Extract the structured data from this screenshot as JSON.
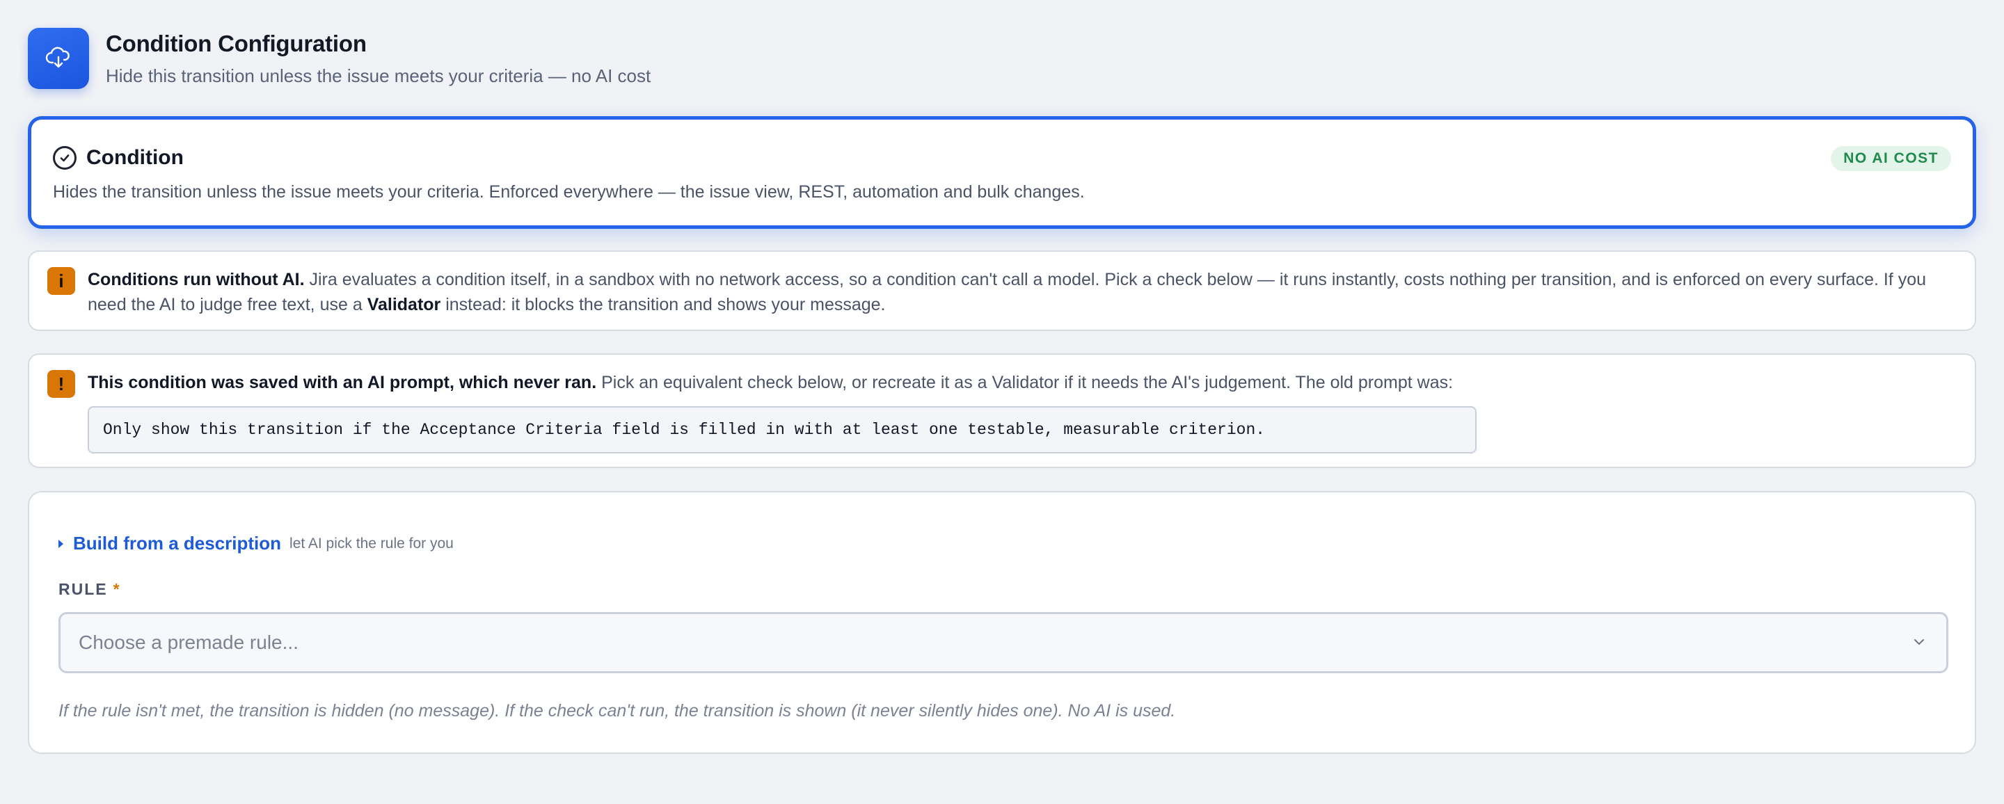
{
  "header": {
    "title": "Condition Configuration",
    "subtitle": "Hide this transition unless the issue meets your criteria — no AI cost",
    "icon": "cloud-download-icon"
  },
  "condition_card": {
    "title": "Condition",
    "badge": "NO AI COST",
    "description": "Hides the transition unless the issue meets your criteria. Enforced everywhere — the issue view, REST, automation and bulk changes.",
    "accent": "#2563eb"
  },
  "info_notice": {
    "marker": "i",
    "bold_lead": "Conditions run without AI.",
    "text_part1": " Jira evaluates a condition itself, in a sandbox with no network access, so a condition can't call a model. Pick a check below — it runs instantly, costs nothing per transition, and is enforced on every surface. If you need the AI to judge free text, use a ",
    "bold_validator": "Validator",
    "text_part2": " instead: it blocks the transition and shows your message."
  },
  "warning_notice": {
    "marker": "!",
    "bold_lead": "This condition was saved with an AI prompt, which never ran.",
    "text": " Pick an equivalent check below, or recreate it as a Validator if it needs the AI's judgement. The old prompt was:",
    "old_prompt": "Only show this transition if the Acceptance Criteria field is filled in with at least one testable, measurable criterion."
  },
  "rule_panel": {
    "build_link": "Build from a description",
    "build_hint": "let AI pick the rule for you",
    "rule_label": "RULE",
    "required_mark": "*",
    "select_placeholder": "Choose a premade rule...",
    "footnote": "If the rule isn't met, the transition is hidden (no message). If the check can't run, the transition is shown (it never silently hides one). No AI is used."
  },
  "colors": {
    "brand": "#2563eb",
    "warning": "#d97706",
    "success_badge": "#1f8a4c"
  }
}
